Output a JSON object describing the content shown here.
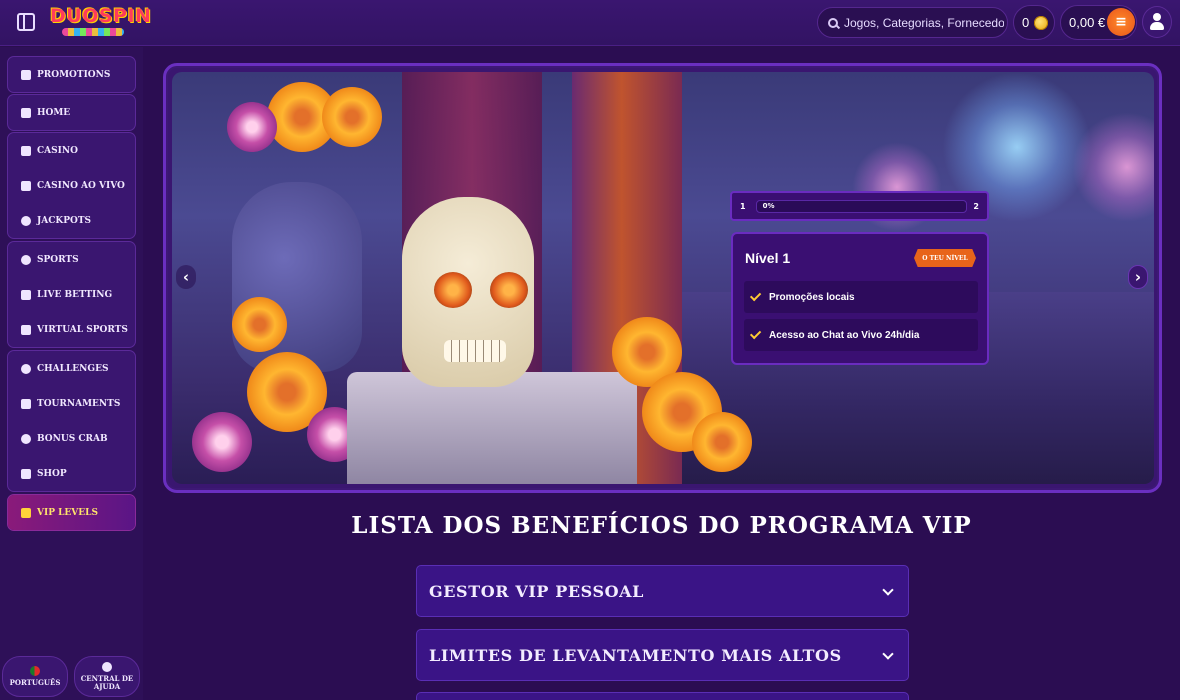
{
  "header": {
    "logo": "DUOSPIN",
    "search_placeholder": "Jogos, Categorias, Fornecedores",
    "coins": "0",
    "balance": "0,00 €"
  },
  "sidebar": {
    "groups": [
      {
        "items": [
          {
            "label": "PROMOTIONS",
            "icon": "gift-icon"
          }
        ]
      },
      {
        "items": [
          {
            "label": "HOME",
            "icon": "home-icon"
          }
        ]
      },
      {
        "items": [
          {
            "label": "CASINO",
            "icon": "slot-machine-icon"
          },
          {
            "label": "CASINO AO VIVO",
            "icon": "phone-icon"
          },
          {
            "label": "JACKPOTS",
            "icon": "clover-icon"
          }
        ]
      },
      {
        "items": [
          {
            "label": "SPORTS",
            "icon": "ball-icon"
          },
          {
            "label": "LIVE BETTING",
            "icon": "play-icon"
          },
          {
            "label": "VIRTUAL SPORTS",
            "icon": "screen-icon"
          }
        ]
      },
      {
        "items": [
          {
            "label": "CHALLENGES",
            "icon": "target-icon"
          },
          {
            "label": "TOURNAMENTS",
            "icon": "trophy-icon"
          },
          {
            "label": "BONUS CRAB",
            "icon": "crab-icon"
          },
          {
            "label": "SHOP",
            "icon": "bag-icon"
          }
        ]
      },
      {
        "items": [
          {
            "label": "VIP LEVELS",
            "icon": "crown-icon",
            "active": true
          }
        ]
      }
    ],
    "language_label": "PORTUGUÊS",
    "help_label": "CENTRAL DE AJUDA"
  },
  "vip": {
    "progress": {
      "current_level": "1",
      "next_level": "2",
      "percent_label": "0%",
      "percent_value": 0
    },
    "level_title": "Nível 1",
    "level_badge": "O TEU NÍVEL",
    "benefits": [
      "Promoções locais",
      "Acesso ao Chat ao Vivo 24h/dia"
    ]
  },
  "benefits_section": {
    "title": "LISTA DOS BENEFÍCIOS DO PROGRAMA VIP",
    "items": [
      "GESTOR VIP PESSOAL",
      "LIMITES DE LEVANTAMENTO MAIS ALTOS"
    ]
  },
  "colors": {
    "accent": "#ffcc33",
    "background": "#2b0d52",
    "panel": "#3a1670",
    "badge": "#e8641a"
  }
}
